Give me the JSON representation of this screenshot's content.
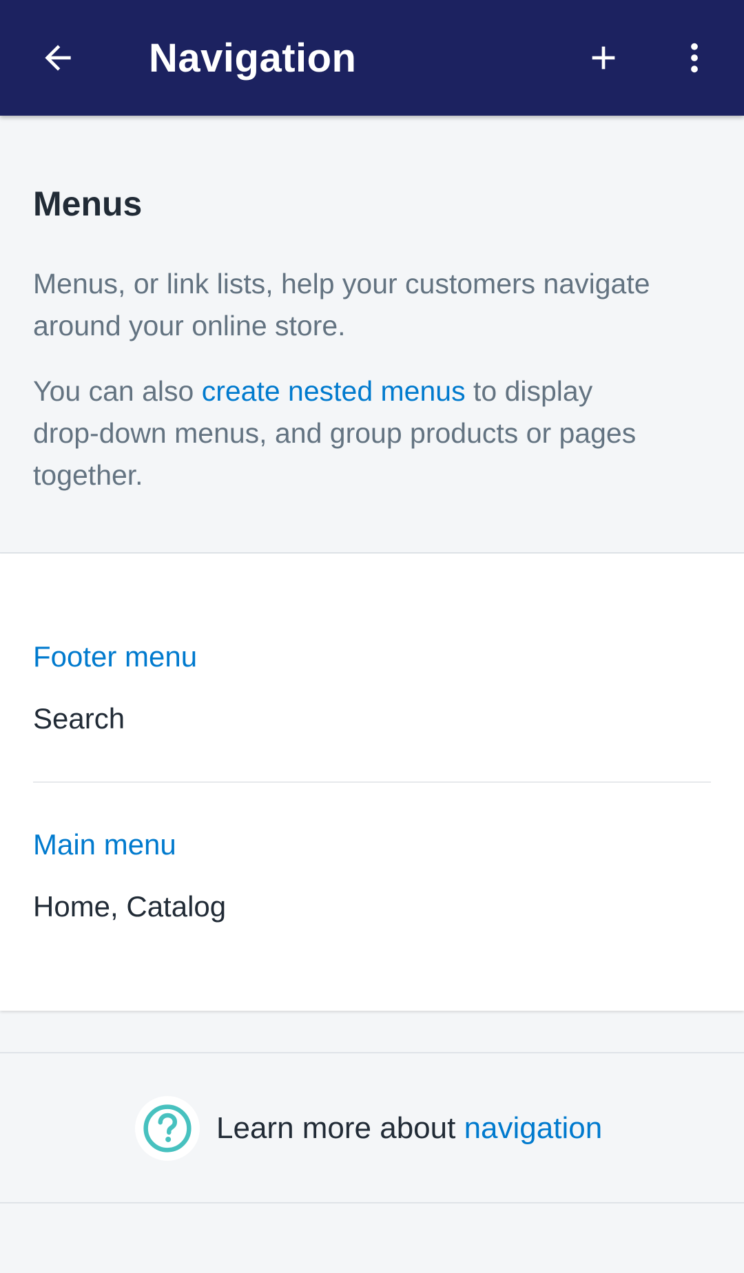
{
  "colors": {
    "appbar": "#1c2260",
    "link": "#007ace",
    "text_primary": "#212b36",
    "text_secondary": "#637381",
    "background": "#f4f6f8",
    "help_icon": "#47c1bf"
  },
  "appbar": {
    "title": "Navigation",
    "back_icon": "arrow-left-icon",
    "add_icon": "plus-icon",
    "more_icon": "more-vertical-icon"
  },
  "intro": {
    "heading": "Menus",
    "paragraph1": "Menus, or link lists, help your customers navigate around your online store.",
    "paragraph2_prefix": "You can also ",
    "paragraph2_link": "create nested menus",
    "paragraph2_suffix": " to display drop-down menus, and group products or pages together."
  },
  "menus": [
    {
      "name": "Footer menu",
      "links": "Search"
    },
    {
      "name": "Main menu",
      "links": "Home, Catalog"
    }
  ],
  "help": {
    "icon": "question-circle-icon",
    "prefix": "Learn more about ",
    "link": "navigation"
  }
}
